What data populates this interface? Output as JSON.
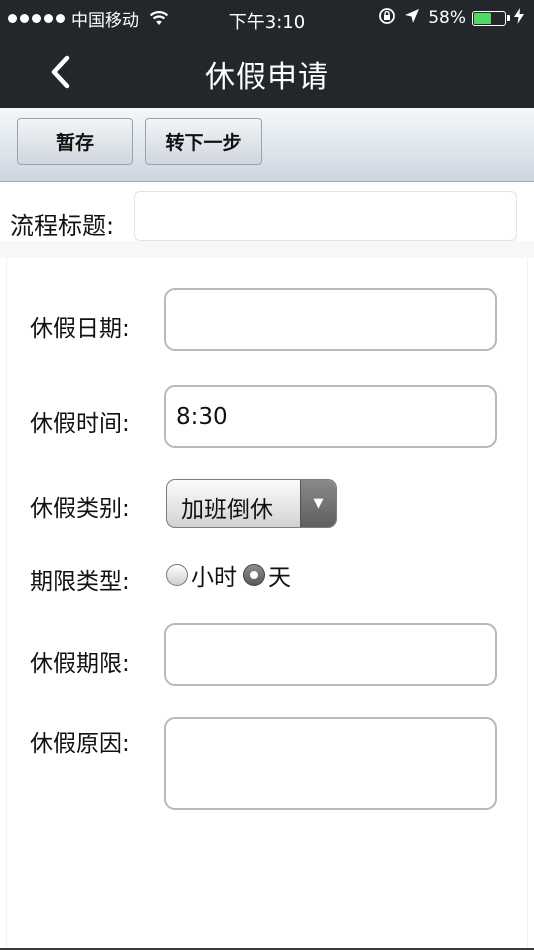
{
  "status_bar": {
    "carrier": "中国移动",
    "time": "下午3:10",
    "battery_percent_text": "58%",
    "battery_level": 0.58,
    "battery_color": "#4cd964"
  },
  "nav": {
    "title": "休假申请",
    "back_icon": "chevron-left-icon"
  },
  "toolbar": {
    "save_label": "暂存",
    "next_label": "转下一步"
  },
  "flow_title": {
    "label": "流程标题:",
    "value": ""
  },
  "form": {
    "leave_date": {
      "label": "休假日期:",
      "value": ""
    },
    "leave_time": {
      "label": "休假时间:",
      "value": "8:30"
    },
    "leave_type": {
      "label": "休假类别:",
      "selected": "加班倒休"
    },
    "duration_type": {
      "label": "期限类型:",
      "options": [
        {
          "label": "小时",
          "checked": false
        },
        {
          "label": "天",
          "checked": true
        }
      ]
    },
    "leave_duration": {
      "label": "休假期限:",
      "value": ""
    },
    "leave_reason": {
      "label": "休假原因:",
      "value": ""
    }
  },
  "colors": {
    "header_bg": "#23272b",
    "toolbar_bg": "#dde5ec"
  }
}
